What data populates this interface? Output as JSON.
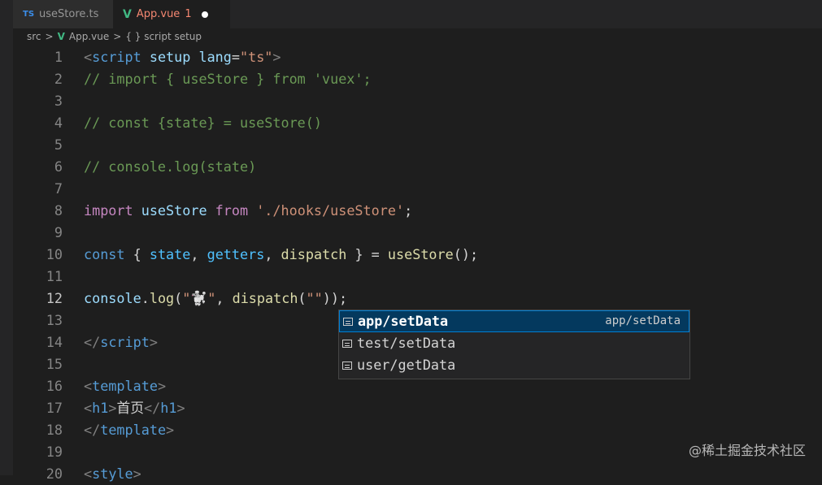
{
  "tabs": [
    {
      "icon": "TS",
      "label": "useStore.ts"
    },
    {
      "icon": "V",
      "label": "App.vue",
      "problems": "1"
    }
  ],
  "breadcrumb": [
    "src",
    ">",
    "App.vue",
    ">",
    "{ } script setup"
  ],
  "lines": [
    [
      [
        "<",
        "#808080"
      ],
      [
        "script",
        "#569cd6"
      ],
      [
        " setup",
        "#9cdcfe"
      ],
      [
        " lang",
        "#9cdcfe"
      ],
      [
        "=",
        "#d4d4d4"
      ],
      [
        "\"ts\"",
        "#ce9178"
      ],
      [
        ">",
        "#808080"
      ]
    ],
    [
      [
        "// import { useStore } from 'vuex';",
        "#6a9955"
      ]
    ],
    [],
    [
      [
        "// const {state} = useStore()",
        "#6a9955"
      ]
    ],
    [],
    [
      [
        "// console.log(state)",
        "#6a9955"
      ]
    ],
    [],
    [
      [
        "import",
        "#c586c0"
      ],
      [
        " useStore ",
        "#9cdcfe"
      ],
      [
        "from",
        "#c586c0"
      ],
      [
        " './hooks/useStore'",
        "#ce9178"
      ],
      [
        ";",
        "#d4d4d4"
      ]
    ],
    [],
    [
      [
        "const",
        "#569cd6"
      ],
      [
        " { ",
        "#d4d4d4"
      ],
      [
        "state",
        "#4fc1ff"
      ],
      [
        ", ",
        "#d4d4d4"
      ],
      [
        "getters",
        "#4fc1ff"
      ],
      [
        ", ",
        "#d4d4d4"
      ],
      [
        "dispatch",
        "#dcdcaa"
      ],
      [
        " } = ",
        "#d4d4d4"
      ],
      [
        "useStore",
        "#dcdcaa"
      ],
      [
        "();",
        "#d4d4d4"
      ]
    ],
    [],
    [
      [
        "console",
        "#9cdcfe"
      ],
      [
        ".",
        "#d4d4d4"
      ],
      [
        "log",
        "#dcdcaa"
      ],
      [
        "(",
        "#d4d4d4"
      ],
      [
        "\"🐩\"",
        "#ce9178"
      ],
      [
        ", ",
        "#d4d4d4"
      ],
      [
        "dispatch",
        "#dcdcaa"
      ],
      [
        "(",
        "#d4d4d4"
      ],
      [
        "\"\"",
        "#ce9178"
      ],
      [
        ")",
        "#d4d4d4"
      ],
      [
        ");",
        "#d4d4d4"
      ]
    ],
    [],
    [
      [
        "</",
        "#808080"
      ],
      [
        "script",
        "#569cd6"
      ],
      [
        ">",
        "#808080"
      ]
    ],
    [],
    [
      [
        "<",
        "#808080"
      ],
      [
        "template",
        "#569cd6"
      ],
      [
        ">",
        "#808080"
      ]
    ],
    [
      [
        "<",
        "#808080"
      ],
      [
        "h1",
        "#569cd6"
      ],
      [
        ">",
        "#808080"
      ],
      [
        "首页",
        "#d4d4d4"
      ],
      [
        "</",
        "#808080"
      ],
      [
        "h1",
        "#569cd6"
      ],
      [
        ">",
        "#808080"
      ]
    ],
    [
      [
        "</",
        "#808080"
      ],
      [
        "template",
        "#569cd6"
      ],
      [
        ">",
        "#808080"
      ]
    ],
    [],
    [
      [
        "<",
        "#808080"
      ],
      [
        "style",
        "#569cd6"
      ],
      [
        ">",
        "#808080"
      ]
    ]
  ],
  "active_line": 12,
  "suggestions": [
    {
      "label": "app/setData",
      "match": "",
      "detail": "app/setData"
    },
    {
      "label": "test/setData"
    },
    {
      "label": "user/getData"
    }
  ],
  "watermark": "@稀土掘金技术社区"
}
